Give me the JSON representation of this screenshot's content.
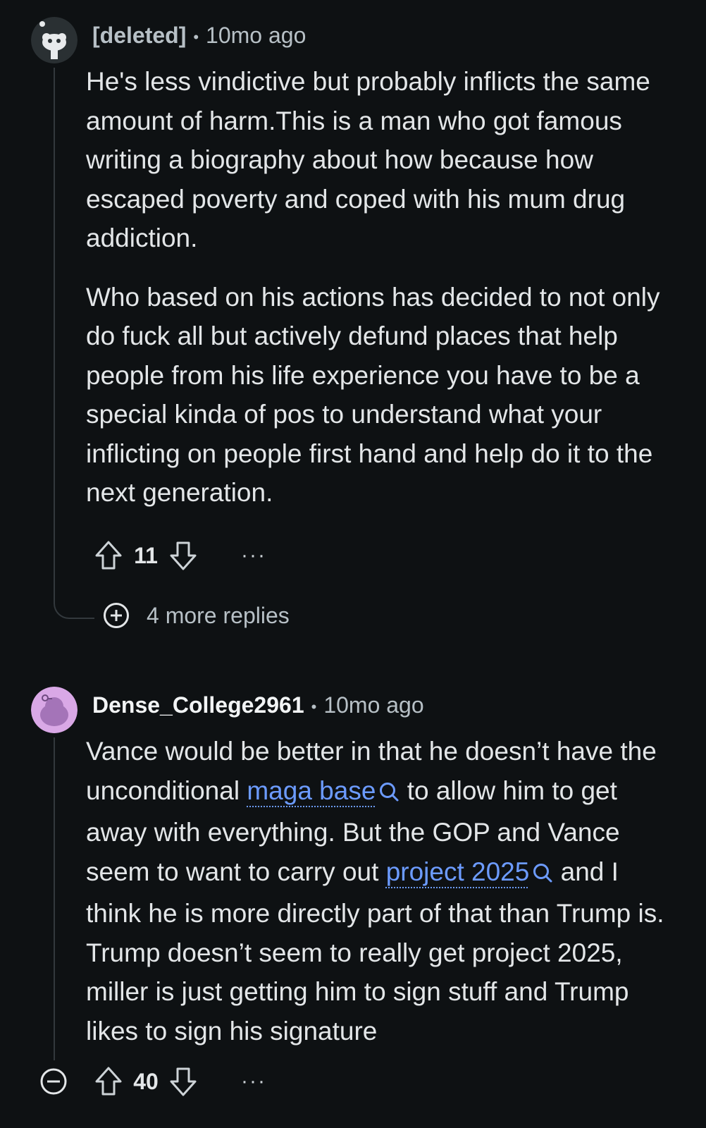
{
  "comments": [
    {
      "author": "[deleted]",
      "separator": "•",
      "time": "10mo ago",
      "paragraphs": [
        "He's less vindictive but probably inflicts the same amount of harm.This is a man who got famous writing a biography about how because how escaped poverty and coped with his mum drug addiction.",
        "Who based on his actions has decided to not only do fuck all but actively defund places that help people from his life experience you have to be a special kinda of pos to understand what your inflicting on people first hand and help do it to the next generation."
      ],
      "score": "11",
      "more_dots": "···",
      "more_replies": "4 more replies"
    },
    {
      "author": "Dense_College2961",
      "separator": "•",
      "time": "10mo ago",
      "text_1": "Vance would be better in that he doesn’t have the unconditional ",
      "link_1": "maga base",
      "text_2": " to allow him to get away with everything. But the GOP and Vance seem to want to carry out ",
      "link_2": "project 2025",
      "text_3": " and I think he is more directly part of that than Trump is. Trump doesn’t seem to really get project 2025, miller is just getting him to sign stuff and Trump likes to sign his signature",
      "score": "40",
      "more_dots": "···"
    }
  ],
  "colors": {
    "background": "#0e1113",
    "text": "#e3e6e8",
    "muted": "#b7c0c6",
    "link": "#6c9bff",
    "thread": "#33393d"
  }
}
